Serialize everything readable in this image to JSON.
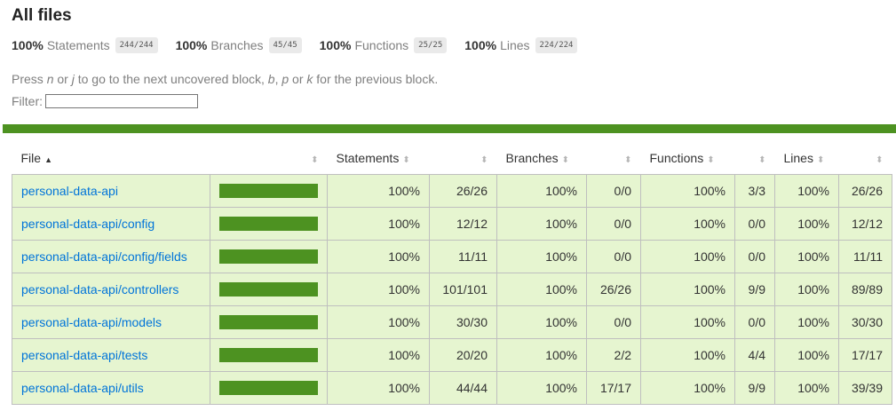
{
  "header": {
    "title": "All files"
  },
  "summary": [
    {
      "pct": "100%",
      "label": "Statements",
      "fraction": "244/244"
    },
    {
      "pct": "100%",
      "label": "Branches",
      "fraction": "45/45"
    },
    {
      "pct": "100%",
      "label": "Functions",
      "fraction": "25/25"
    },
    {
      "pct": "100%",
      "label": "Lines",
      "fraction": "224/224"
    }
  ],
  "help": {
    "t1": "Press ",
    "k1": "n",
    "t2": " or ",
    "k2": "j",
    "t3": " to go to the next uncovered block, ",
    "k3": "b",
    "t4": ", ",
    "k4": "p",
    "t5": " or ",
    "k5": "k",
    "t6": " for the previous block."
  },
  "filter": {
    "label": "Filter:",
    "value": ""
  },
  "table": {
    "headers": {
      "file": "File",
      "sort_asc": "▲",
      "sort": "⬍",
      "statements": "Statements",
      "branches": "Branches",
      "functions": "Functions",
      "lines": "Lines"
    },
    "rows": [
      {
        "file": "personal-data-api",
        "coverage": 1.0,
        "stmt_pct": "100%",
        "stmt_frac": "26/26",
        "br_pct": "100%",
        "br_frac": "0/0",
        "fn_pct": "100%",
        "fn_frac": "3/3",
        "ln_pct": "100%",
        "ln_frac": "26/26"
      },
      {
        "file": "personal-data-api/config",
        "coverage": 1.0,
        "stmt_pct": "100%",
        "stmt_frac": "12/12",
        "br_pct": "100%",
        "br_frac": "0/0",
        "fn_pct": "100%",
        "fn_frac": "0/0",
        "ln_pct": "100%",
        "ln_frac": "12/12"
      },
      {
        "file": "personal-data-api/config/fields",
        "coverage": 1.0,
        "stmt_pct": "100%",
        "stmt_frac": "11/11",
        "br_pct": "100%",
        "br_frac": "0/0",
        "fn_pct": "100%",
        "fn_frac": "0/0",
        "ln_pct": "100%",
        "ln_frac": "11/11"
      },
      {
        "file": "personal-data-api/controllers",
        "coverage": 1.0,
        "stmt_pct": "100%",
        "stmt_frac": "101/101",
        "br_pct": "100%",
        "br_frac": "26/26",
        "fn_pct": "100%",
        "fn_frac": "9/9",
        "ln_pct": "100%",
        "ln_frac": "89/89"
      },
      {
        "file": "personal-data-api/models",
        "coverage": 1.0,
        "stmt_pct": "100%",
        "stmt_frac": "30/30",
        "br_pct": "100%",
        "br_frac": "0/0",
        "fn_pct": "100%",
        "fn_frac": "0/0",
        "ln_pct": "100%",
        "ln_frac": "30/30"
      },
      {
        "file": "personal-data-api/tests",
        "coverage": 1.0,
        "stmt_pct": "100%",
        "stmt_frac": "20/20",
        "br_pct": "100%",
        "br_frac": "2/2",
        "fn_pct": "100%",
        "fn_frac": "4/4",
        "ln_pct": "100%",
        "ln_frac": "17/17"
      },
      {
        "file": "personal-data-api/utils",
        "coverage": 1.0,
        "stmt_pct": "100%",
        "stmt_frac": "44/44",
        "br_pct": "100%",
        "br_frac": "17/17",
        "fn_pct": "100%",
        "fn_frac": "9/9",
        "ln_pct": "100%",
        "ln_frac": "39/39"
      }
    ]
  },
  "colors": {
    "status_high": "#4d9221",
    "row_high": "#e6f5d0",
    "link": "#0074d9"
  }
}
